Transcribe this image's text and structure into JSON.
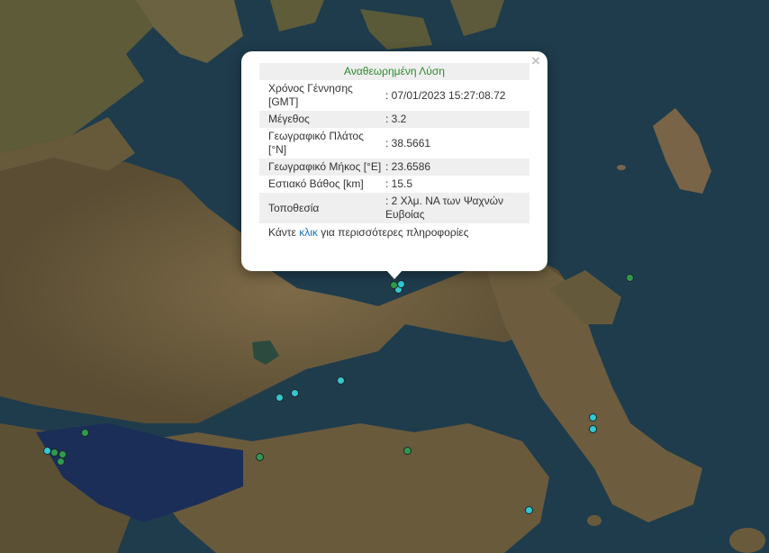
{
  "popup": {
    "header": "Αναθεωρημένη Λύση",
    "rows": [
      {
        "label": "Χρόνος Γέννησης [GMT]",
        "value": ": 07/01/2023 15:27:08.72"
      },
      {
        "label": "Μέγεθος",
        "value": ": 3.2"
      },
      {
        "label": "Γεωγραφικό Πλάτος [°N]",
        "value": ": 38.5661"
      },
      {
        "label": "Γεωγραφικό Μήκος [°E]",
        "value": ": 23.6586"
      },
      {
        "label": "Εστιακό Βάθος [km]",
        "value": ": 15.5"
      },
      {
        "label": "Τοποθεσία",
        "value": ": 2 Χλμ. ΝΑ των Ψαχνών Ευβοίας"
      }
    ],
    "more_before": "Κάντε ",
    "more_link": "κλικ",
    "more_after": " για περισσότερες πληροφορίες",
    "close_label": "×"
  },
  "colors": {
    "marker_cyan": "#33c7cf",
    "marker_green": "#2f9a4e",
    "sea": "#1e3a4a",
    "land": "#6b5a3c"
  },
  "markers": [
    {
      "name": "marker-1",
      "color": "green"
    },
    {
      "name": "marker-2",
      "color": "cyan"
    },
    {
      "name": "marker-3",
      "color": "cyan"
    },
    {
      "name": "marker-4",
      "color": "green"
    },
    {
      "name": "marker-5",
      "color": "cyan"
    },
    {
      "name": "marker-6",
      "color": "cyan"
    },
    {
      "name": "marker-7",
      "color": "cyan"
    },
    {
      "name": "marker-8",
      "color": "green"
    },
    {
      "name": "marker-9",
      "color": "cyan"
    },
    {
      "name": "marker-10",
      "color": "green"
    },
    {
      "name": "marker-11",
      "color": "green"
    },
    {
      "name": "marker-12",
      "color": "green"
    },
    {
      "name": "marker-13",
      "color": "green"
    },
    {
      "name": "marker-14",
      "color": "cyan"
    },
    {
      "name": "marker-15",
      "color": "cyan"
    },
    {
      "name": "marker-16",
      "color": "cyan"
    },
    {
      "name": "marker-17",
      "color": "green"
    }
  ]
}
